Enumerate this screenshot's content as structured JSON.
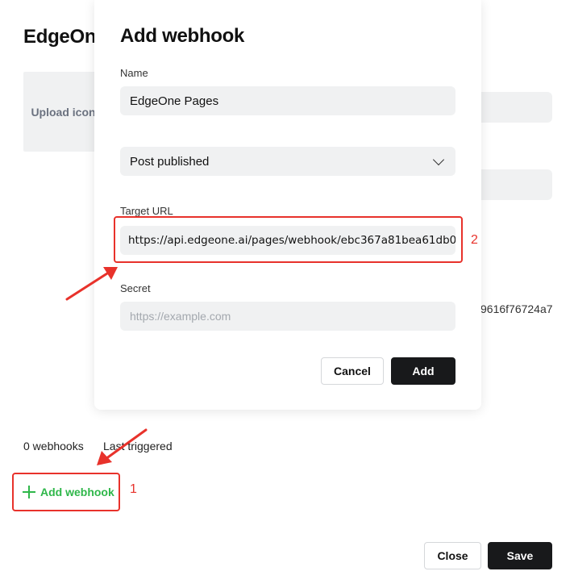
{
  "background": {
    "title": "EdgeOne",
    "upload_icon": "Upload icon",
    "secret_fragment": "9616f76724a7",
    "webhooks_count": "0 webhooks",
    "last_triggered": "Last triggered",
    "add_webhook_label": "Add webhook",
    "close_label": "Close",
    "save_label": "Save"
  },
  "modal": {
    "title": "Add webhook",
    "name_label": "Name",
    "name_value": "EdgeOne Pages",
    "event_selected": "Post published",
    "target_url_label": "Target URL",
    "target_url_value": "https://api.edgeone.ai/pages/webhook/ebc367a81bea61db0",
    "secret_label": "Secret",
    "secret_placeholder": "https://example.com",
    "cancel_label": "Cancel",
    "add_label": "Add"
  },
  "annotations": {
    "step_1": "1",
    "step_2": "2"
  },
  "colors": {
    "accent_green": "#2fb74a",
    "annotation_red": "#e8322b",
    "dark_button": "#18191b",
    "field_bg": "#f0f1f2"
  },
  "icons": [
    "plus-icon",
    "chevron-down-icon",
    "arrow-annotation"
  ]
}
